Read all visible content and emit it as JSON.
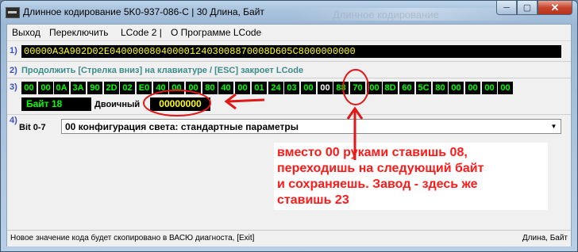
{
  "window": {
    "title": "Длинное кодирование  5K0-937-086-C | 30 Длина, Байт",
    "ghost_title": "Длинное кодирование",
    "min_glyph": "─",
    "max_glyph": "▢",
    "close_glyph": "✕"
  },
  "menu": {
    "items": [
      "Выход",
      "Переключить",
      "LCode 2 |",
      "О Программе LCode"
    ]
  },
  "rows": {
    "n1": "1)",
    "n2": "2)",
    "n3": "3)",
    "n4": "4)"
  },
  "coding": {
    "full_code": "00000A3A902D02E0400000804000012403008870008D605C8000000000",
    "hint": "Продолжить [Стрелка вниз] на клавиатуре / [ESC] закроет LCode",
    "bytes": [
      "00",
      "00",
      "0A",
      "3A",
      "90",
      "2D",
      "02",
      "E0",
      "40",
      "00",
      "00",
      "80",
      "40",
      "00",
      "01",
      "24",
      "03",
      "00",
      "00",
      "88",
      "70",
      "00",
      "8D",
      "60",
      "5C",
      "80",
      "00",
      "00",
      "00",
      "00"
    ],
    "selected_index": 18,
    "byte_label": "Байт 18",
    "binary_label": "Двоичный",
    "binary_value": "00000000",
    "bit_label": "Bit 0-7",
    "dropdown_value": "00 конфигурация света: стандартные параметры"
  },
  "status": {
    "text": "Новое значение кода будет скопировано в ВАСЮ диагноста, [Exit]",
    "right_text": "Длина, Байт"
  },
  "annotation": {
    "lines": [
      "вместо 00 руками ставишь 08,",
      "переходишь на следующий байт",
      "и сохраняешь. Завод - здесь же",
      "ставишь 23"
    ],
    "color": "#ff1a1a"
  },
  "colors": {
    "code_text": "#ffff00",
    "byte_text": "#00ff00",
    "row_number": "#3b4fc8",
    "hint_text": "#3c8c8c"
  }
}
